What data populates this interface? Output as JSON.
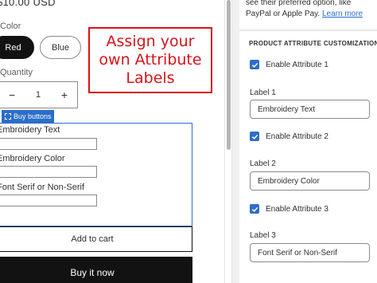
{
  "preview": {
    "price": "$10.00 USD",
    "color_label": "Color",
    "swatches": [
      "Red",
      "Blue"
    ],
    "quantity_label": "Quantity",
    "quantity": {
      "minus": "−",
      "value": "1",
      "plus": "+"
    },
    "buy_buttons_tag": "Buy buttons",
    "attributes": [
      {
        "label": "Embroidery Text"
      },
      {
        "label": "Embroidery Color"
      },
      {
        "label": "Font Serif or Non-Serif"
      }
    ],
    "add_to_cart": "Add to cart",
    "buy_now": "Buy it now"
  },
  "annotation": {
    "line1": "Assign your",
    "line2": "own Attribute",
    "line3": "Labels",
    "color": "#d5141b"
  },
  "panel": {
    "info_line1": "see their preferred option, like",
    "info_line2_prefix": "PayPal or Apple Pay. ",
    "info_link": "Learn more",
    "section_title": "PRODUCT ATTRIBUTE CUSTOMIZATION",
    "attributes": [
      {
        "enable_label": "Enable Attribute 1",
        "checked": true,
        "field_label": "Label 1",
        "value": "Embroidery Text"
      },
      {
        "enable_label": "Enable Attribute 2",
        "checked": true,
        "field_label": "Label 2",
        "value": "Embroidery Color"
      },
      {
        "enable_label": "Enable Attribute 3",
        "checked": true,
        "field_label": "Label 3",
        "value": "Font Serif or Non-Serif"
      }
    ]
  },
  "colors": {
    "accent": "#2c6ecb",
    "button_dark": "#121212",
    "panel_bg": "#f1f1f1"
  },
  "icons": [
    "checkmark-icon",
    "select-frame-icon"
  ]
}
